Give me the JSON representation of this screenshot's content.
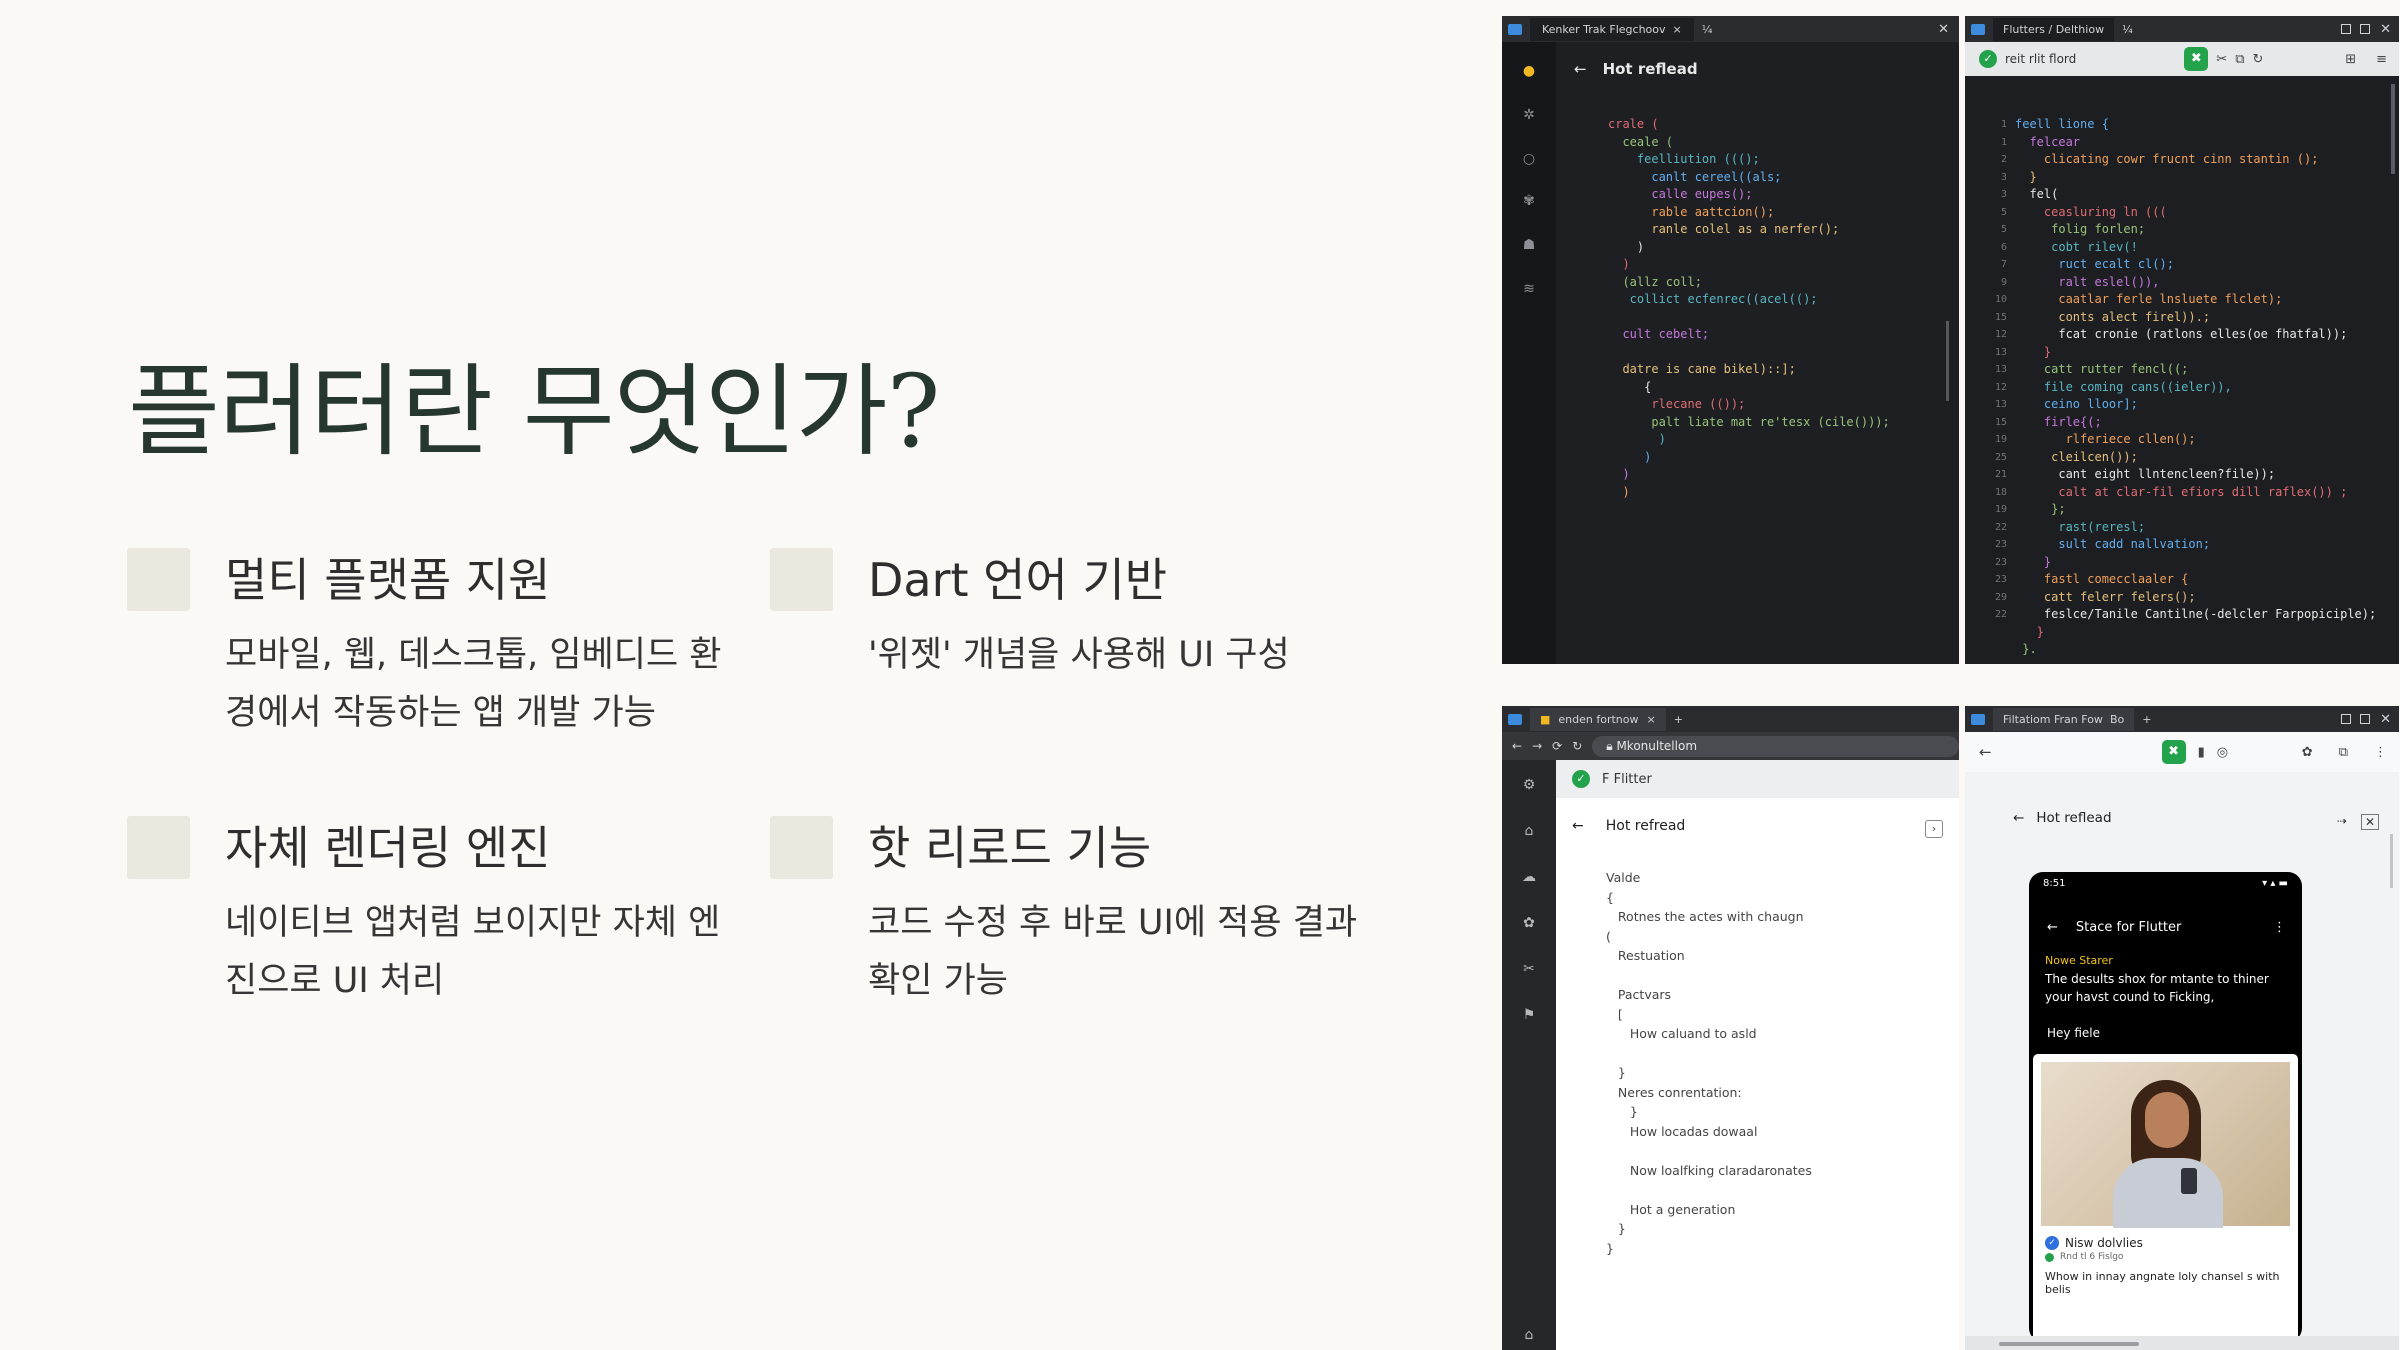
{
  "slide": {
    "title": "플러터란 무엇인가?",
    "features": [
      {
        "title": "멀티 플랫폼 지원",
        "desc": "모바일, 웹, 데스크톱, 임베디드 환경에서 작동하는 앱 개발 가능"
      },
      {
        "title": "Dart 언어 기반",
        "desc": "'위젯' 개념을 사용해 UI 구성"
      },
      {
        "title": "자체 렌더링 엔진",
        "desc": "네이티브 앱처럼 보이지만 자체 엔진으로 UI 처리"
      },
      {
        "title": "핫 리로드 기능",
        "desc": "코드 수정 후 바로 UI에 적용 결과 확인 가능"
      }
    ]
  },
  "window1": {
    "tab": "Kenker Trak Flegchoov",
    "tab_extra": "¼",
    "header": "Hot reflead",
    "code": "crale (\n  ceale (\n    feelliution ((();\n      canlt cereel((als;\n      calle eupes();\n      rable aattcion();\n      ranle colel as a nerfer();\n    )\n  )\n  (allz coll;\n   collict ecfenrec((acel(();\n\n  cult cebelt;\n\n  datre is cane bikel)::];\n     {\n      rlecane (());\n      palt liate mat re'tesx (cile()));\n       )\n     )\n  )\n  )"
  },
  "window2": {
    "tab": "Flutters / Delthiow",
    "tab_extra": "¼",
    "file_label": "reit rlit flord",
    "gutter": "1\n1\n2\n3\n3\n5\n5\n6\n7\n9\n10\n15\n12\n13\n13\n12\n13\n15\n19\n25\n21\n18\n19\n22\n23\n23\n23\n29\n22",
    "code": "feell lione {\n  felcear\n    clicating cowr frucnt cinn stantin ();\n  }\n  fel(\n    ceasluring ln (((\n     folig forlen;\n     cobt rilev(!\n      ruct ecalt cl();\n      ralt eslel()),\n      caatlar ferle lnsluete flclet);\n      conts alect firel)).;\n      fcat cronie (ratlons elles(oe fhatfal));\n    }\n    catt rutter fencl((;\n    file coming cans((ieler)),\n    ceino lloor];\n    firle{(;\n       rlferiece cllen();\n     cleilcen());\n      cant eight llntencleen?file));\n      calt at clar-fil efiors dill raflex()) ;\n     };\n      rast(reresl;\n      sult cadd nallvation;\n    }\n    fastl comecclaaler {\n    catt felerr felers();\n    feslce/Tanile Cantilne(-delcler Farpopiciple);\n   }\n }."
  },
  "window3": {
    "tab": "enden fortnow",
    "url": "Mkonultellom",
    "brand": "F Flitter",
    "header": "Hot refread",
    "code": "Valde\n{\n   Rotnes the actes with chaugn\n(\n   Restuation\n\n   Pactvars\n   [\n      How caluand to asld\n\n   }\n   Neres conrentation:\n      }\n      How locadas dowaal\n\n      Now loalfking claradaronates\n\n      Hot a generation\n   }\n}"
  },
  "window4": {
    "tab": "Filtatiom Fran Fow",
    "tab_extra": "Bo",
    "header": "Hot reflead",
    "phone": {
      "time": "8:51",
      "appbar": "Stace for Flutter",
      "news_label": "Nowe Starer",
      "body": "The desults shox for mtante to thiner your havst cound to Ficking,",
      "hey": "Hey fiele",
      "card_title": "Nisw dolvlies",
      "card_sub": "Rnd tl 6 Fislgo",
      "card_text": "Whow in innay angnate loly chansel s with belis"
    }
  }
}
